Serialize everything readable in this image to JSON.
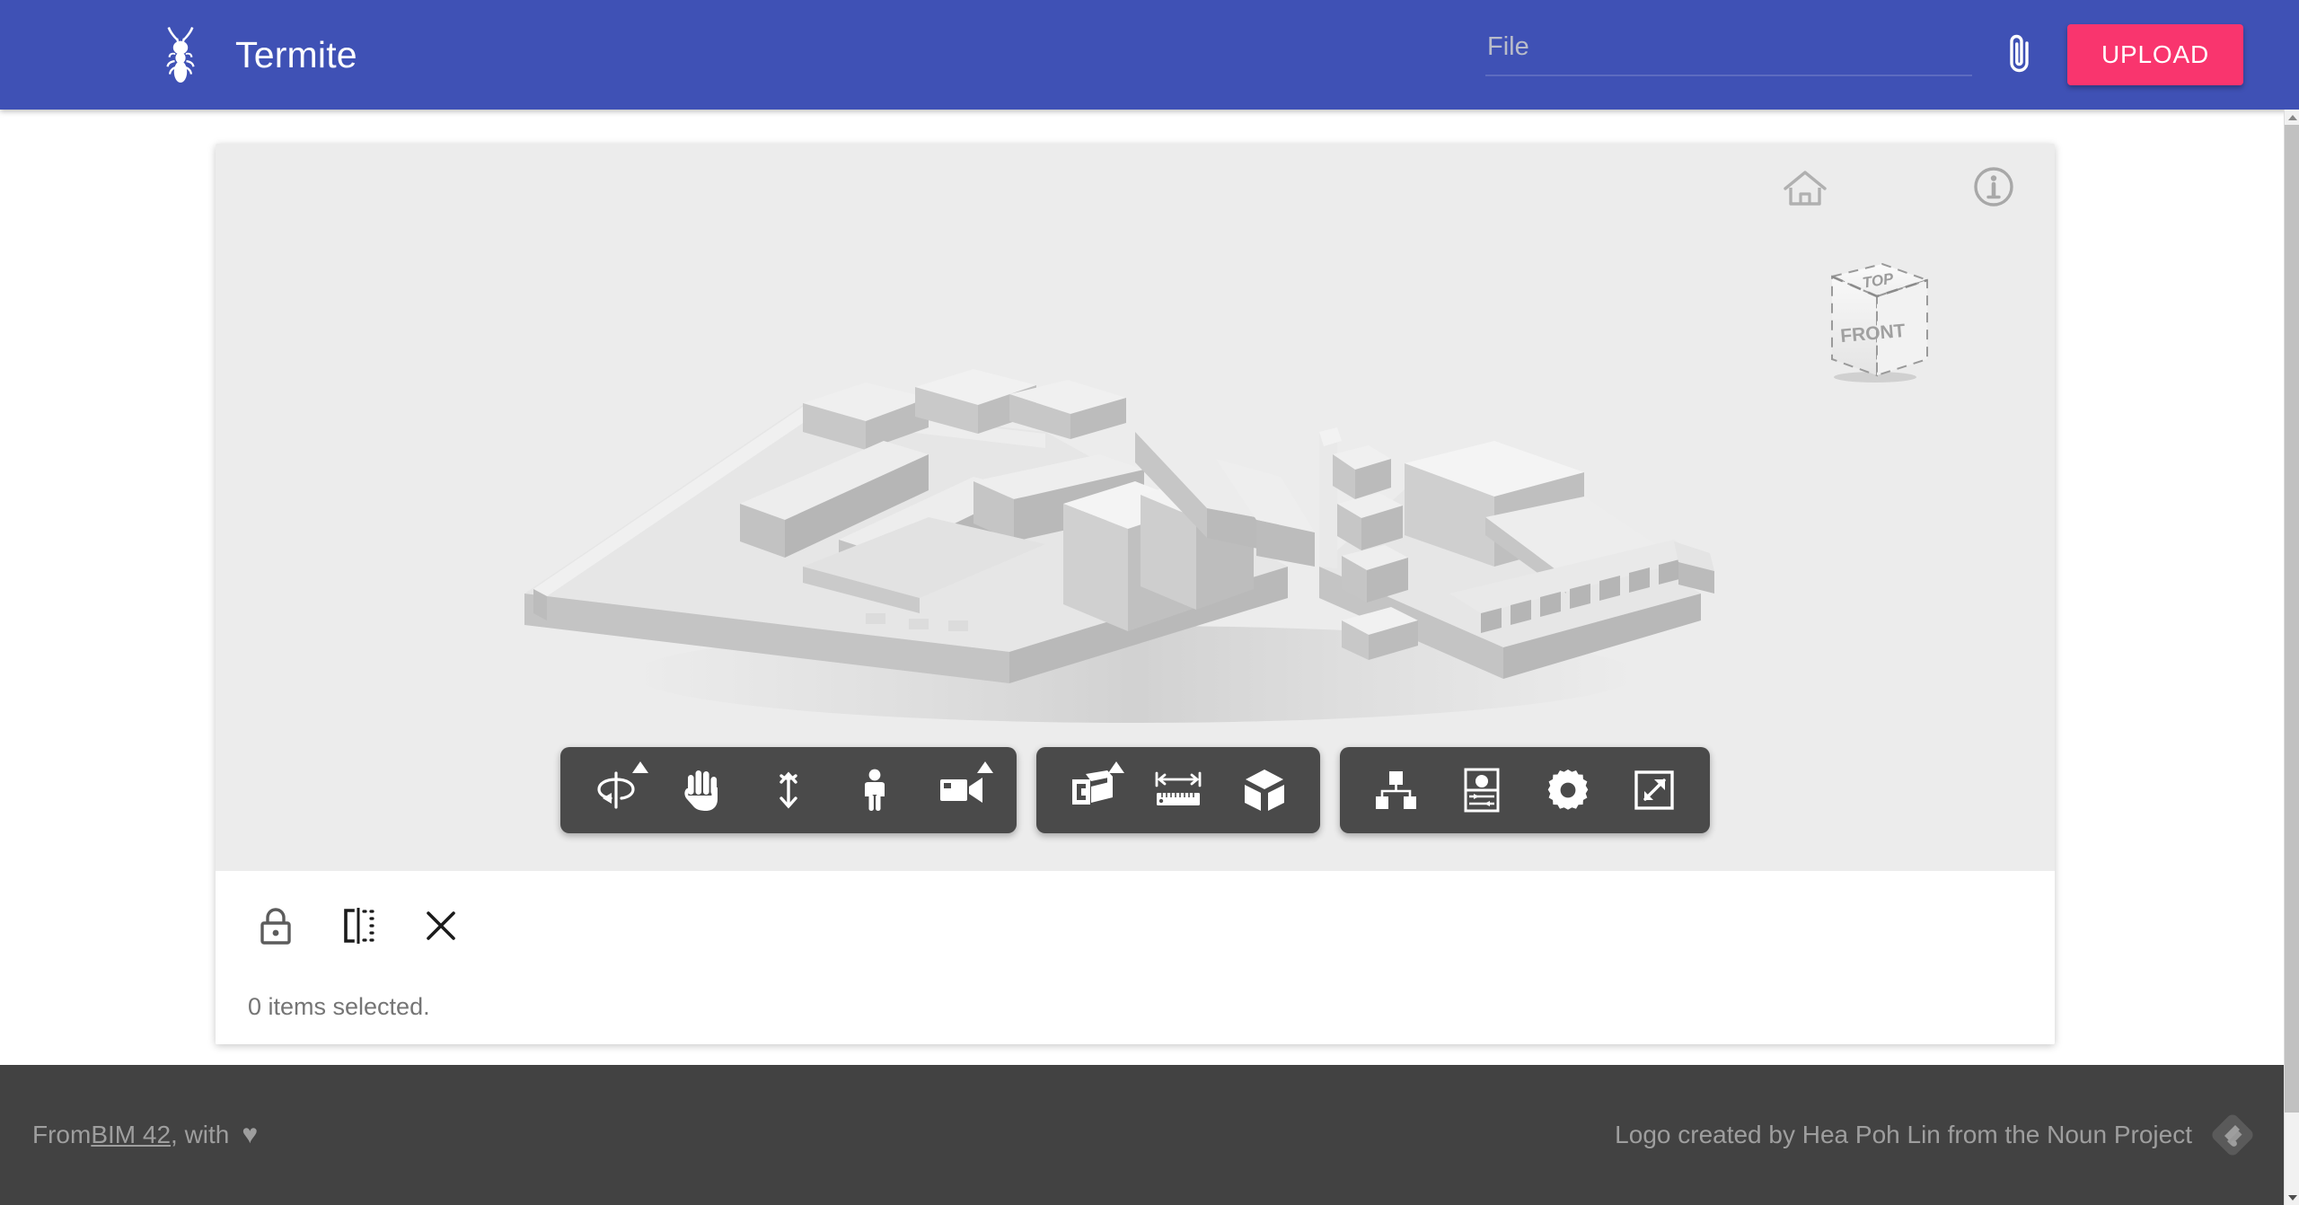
{
  "header": {
    "logo_icon": "termite-logo-icon",
    "title": "Termite",
    "file_input": {
      "value": "",
      "placeholder": "File"
    },
    "attach_icon": "paperclip-icon",
    "upload_label": "UPLOAD",
    "bg_color": "#3f51b5",
    "accent_color": "#f9356e"
  },
  "viewer": {
    "bg_color": "#ececec",
    "home_icon": "home-icon",
    "info_icon": "info-icon",
    "viewcube": {
      "top_face": "TOP",
      "front_face": "FRONT"
    },
    "model": {
      "kind": "bim-building-massing",
      "color": "#d8d8d8"
    },
    "toolbar_groups": [
      {
        "name": "navigation",
        "buttons": [
          {
            "name": "orbit-icon",
            "label": "Orbit",
            "has_dropdown": true
          },
          {
            "name": "pan-hand-icon",
            "label": "Pan",
            "has_dropdown": false
          },
          {
            "name": "zoom-arrows-icon",
            "label": "Zoom",
            "has_dropdown": false
          },
          {
            "name": "walk-person-icon",
            "label": "Walk",
            "has_dropdown": false
          },
          {
            "name": "camera-icon",
            "label": "Camera",
            "has_dropdown": true
          }
        ]
      },
      {
        "name": "tools",
        "buttons": [
          {
            "name": "section-box-icon",
            "label": "Section",
            "has_dropdown": true
          },
          {
            "name": "measure-ruler-icon",
            "label": "Measure",
            "has_dropdown": false
          },
          {
            "name": "explode-cube-icon",
            "label": "Explode",
            "has_dropdown": false
          }
        ]
      },
      {
        "name": "panels",
        "buttons": [
          {
            "name": "model-tree-icon",
            "label": "Model tree",
            "has_dropdown": false
          },
          {
            "name": "properties-panel-icon",
            "label": "Properties",
            "has_dropdown": false
          },
          {
            "name": "gear-settings-icon",
            "label": "Settings",
            "has_dropdown": false
          },
          {
            "name": "fullscreen-icon",
            "label": "Fullscreen",
            "has_dropdown": false
          }
        ]
      }
    ]
  },
  "selection": {
    "buttons": [
      {
        "name": "lock-icon",
        "label": "Lock"
      },
      {
        "name": "isolate-icon",
        "label": "Isolate"
      },
      {
        "name": "close-icon",
        "label": "Close"
      }
    ],
    "status_text": "0 items selected."
  },
  "footer": {
    "bg_color": "#424242",
    "from_prefix": "From ",
    "link_text": "BIM 42",
    "from_suffix": ", with ",
    "heart_glyph": "♥",
    "credit": "Logo created by Hea Poh Lin from the Noun Project",
    "feedly_icon": "feedly-icon"
  },
  "scrollbar": {
    "up_icon": "scroll-up-arrow-icon",
    "down_icon": "scroll-down-arrow-icon"
  }
}
